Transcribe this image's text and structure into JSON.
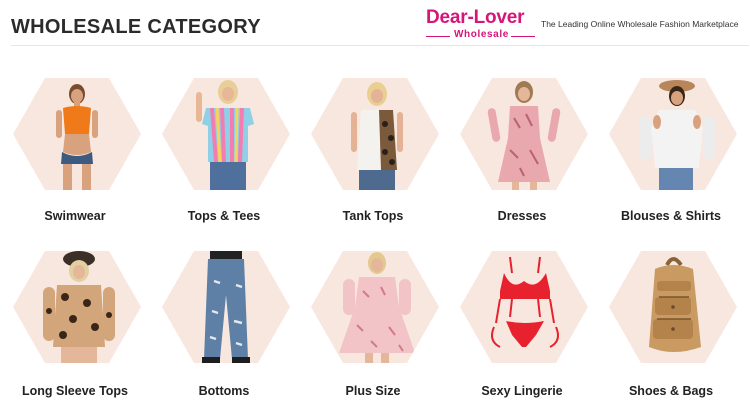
{
  "header": {
    "title": "WHOLESALE CATEGORY",
    "logo_main": "Dear-Lover",
    "logo_sub": "Wholesale",
    "tagline": "The Leading Online Wholesale Fashion Marketplace"
  },
  "categories": [
    {
      "label": "Swimwear",
      "icon": "swimwear-model-image"
    },
    {
      "label": "Tops & Tees",
      "icon": "tops-tees-model-image"
    },
    {
      "label": "Tank Tops",
      "icon": "tank-tops-model-image"
    },
    {
      "label": "Dresses",
      "icon": "dresses-model-image"
    },
    {
      "label": "Blouses & Shirts",
      "icon": "blouses-shirts-model-image"
    },
    {
      "label": "Long Sleeve Tops",
      "icon": "long-sleeve-tops-model-image"
    },
    {
      "label": "Bottoms",
      "icon": "bottoms-jeans-image"
    },
    {
      "label": "Plus Size",
      "icon": "plus-size-model-image"
    },
    {
      "label": "Sexy Lingerie",
      "icon": "lingerie-image"
    },
    {
      "label": "Shoes & Bags",
      "icon": "bag-image"
    }
  ],
  "colors": {
    "brand": "#d6157a",
    "hex_bg": "#f8e7df",
    "title": "#2b2b2b"
  }
}
